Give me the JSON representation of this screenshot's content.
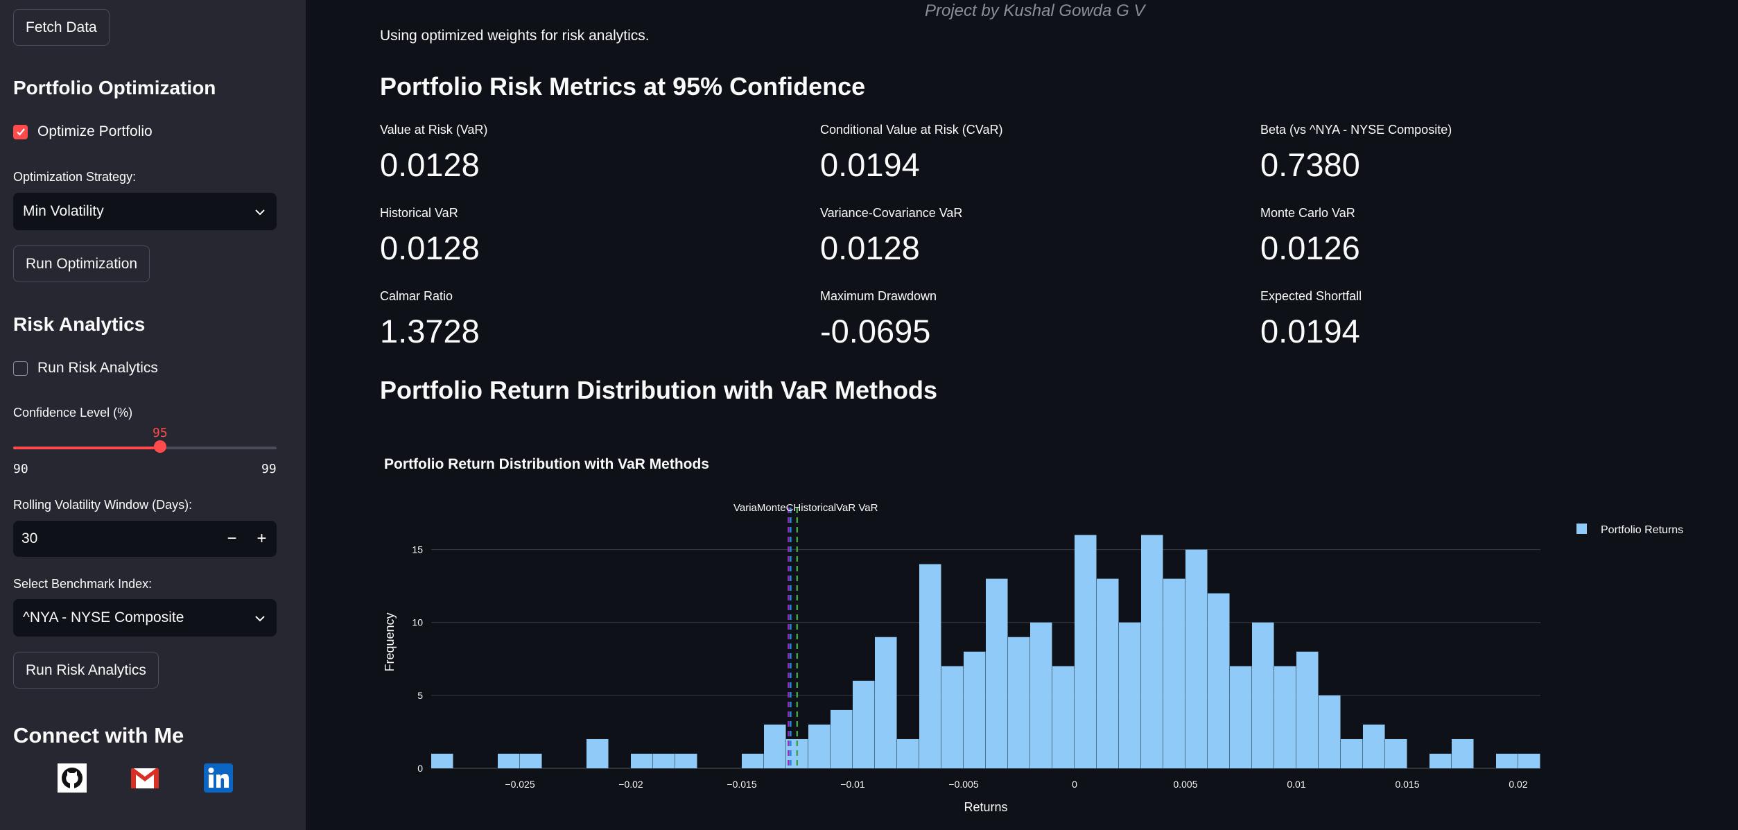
{
  "sidebar": {
    "fetch_button": "Fetch Data",
    "optimization_heading": "Portfolio Optimization",
    "optimize_checkbox": {
      "label": "Optimize Portfolio",
      "checked": true
    },
    "strategy_label": "Optimization Strategy:",
    "strategy_value": "Min Volatility",
    "run_optimization_button": "Run Optimization",
    "risk_heading": "Risk Analytics",
    "risk_checkbox": {
      "label": "Run Risk Analytics",
      "checked": false
    },
    "confidence_label": "Confidence Level (%)",
    "confidence_slider": {
      "value": "95",
      "min": "90",
      "max": "99"
    },
    "window_label": "Rolling Volatility Window (Days):",
    "window_value": "30",
    "benchmark_label": "Select Benchmark Index:",
    "benchmark_value": "^NYA - NYSE Composite",
    "run_risk_button": "Run Risk Analytics",
    "connect_heading": "Connect with Me",
    "social_icons": [
      "github-icon",
      "gmail-icon",
      "linkedin-icon"
    ]
  },
  "main": {
    "subtitle": "Project by Kushal Gowda G V",
    "info": "Using optimized weights for risk analytics.",
    "metrics_heading": "Portfolio Risk Metrics at 95% Confidence",
    "metrics": [
      {
        "label": "Value at Risk (VaR)",
        "value": "0.0128"
      },
      {
        "label": "Conditional Value at Risk (CVaR)",
        "value": "0.0194"
      },
      {
        "label": "Beta (vs ^NYA - NYSE Composite)",
        "value": "0.7380"
      },
      {
        "label": "Historical VaR",
        "value": "0.0128"
      },
      {
        "label": "Variance-Covariance VaR",
        "value": "0.0128"
      },
      {
        "label": "Monte Carlo VaR",
        "value": "0.0126"
      },
      {
        "label": "Calmar Ratio",
        "value": "1.3728"
      },
      {
        "label": "Maximum Drawdown",
        "value": "-0.0695"
      },
      {
        "label": "Expected Shortfall",
        "value": "0.0194"
      }
    ],
    "distribution_heading": "Portfolio Return Distribution with VaR Methods"
  },
  "colors": {
    "accent": "#ff4b4b",
    "bars": "#90caf9",
    "historical": "#9c27b0",
    "variance": "#1e88e5",
    "montecarlo": "#43a047"
  },
  "chart_data": {
    "type": "bar",
    "title": "Portfolio Return Distribution with VaR Methods",
    "xlabel": "Returns",
    "ylabel": "Frequency",
    "xlim": [
      -0.029,
      0.021
    ],
    "ylim": [
      0,
      17.5
    ],
    "x_ticks": [
      -0.025,
      -0.02,
      -0.015,
      -0.01,
      -0.005,
      0,
      0.005,
      0.01,
      0.015,
      0.02
    ],
    "x_tick_labels": [
      "−0.025",
      "−0.02",
      "−0.015",
      "−0.01",
      "−0.005",
      "0",
      "0.005",
      "0.01",
      "0.015",
      "0.02"
    ],
    "y_ticks": [
      0,
      5,
      10,
      15
    ],
    "grid": true,
    "legend": {
      "position": "top-right",
      "entries": [
        "Portfolio Returns"
      ]
    },
    "bin_width": 0.001,
    "bin_starts": [
      -0.029,
      -0.028,
      -0.027,
      -0.026,
      -0.025,
      -0.024,
      -0.023,
      -0.022,
      -0.021,
      -0.02,
      -0.019,
      -0.018,
      -0.017,
      -0.016,
      -0.015,
      -0.014,
      -0.013,
      -0.012,
      -0.011,
      -0.01,
      -0.009,
      -0.008,
      -0.007,
      -0.006,
      -0.005,
      -0.004,
      -0.003,
      -0.002,
      -0.001,
      0.0,
      0.001,
      0.002,
      0.003,
      0.004,
      0.005,
      0.006,
      0.007,
      0.008,
      0.009,
      0.01,
      0.011,
      0.012,
      0.013,
      0.014,
      0.015,
      0.016,
      0.017,
      0.018,
      0.019,
      0.02
    ],
    "counts": [
      1,
      0,
      0,
      1,
      1,
      0,
      0,
      2,
      0,
      1,
      1,
      1,
      0,
      0,
      1,
      3,
      2,
      3,
      4,
      6,
      9,
      2,
      14,
      7,
      8,
      13,
      9,
      10,
      7,
      16,
      13,
      10,
      16,
      13,
      15,
      12,
      7,
      10,
      7,
      8,
      5,
      2,
      3,
      2,
      0,
      1,
      2,
      0,
      1,
      1
    ],
    "var_lines": [
      {
        "name": "Historical VaR",
        "x": -0.0128
      },
      {
        "name": "Variance-Covariance VaR",
        "x": -0.0128
      },
      {
        "name": "Monte Carlo VaR",
        "x": -0.0126
      }
    ],
    "var_label_text": "VariaMonteCHistoricalVaR VaR"
  }
}
